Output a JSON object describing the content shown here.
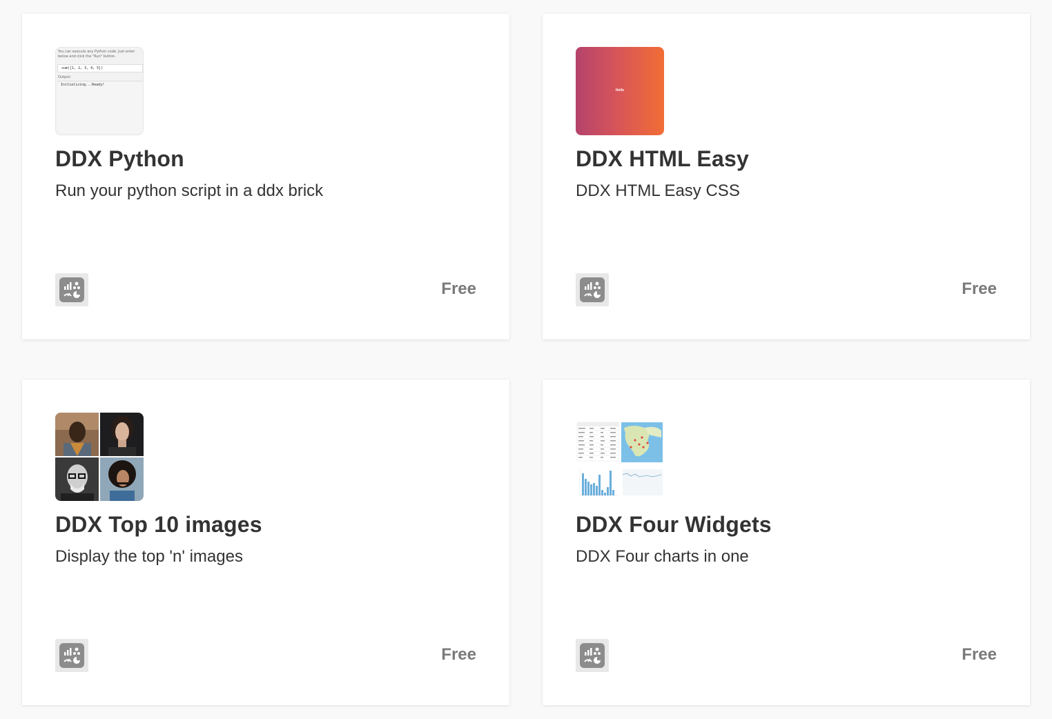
{
  "cards": [
    {
      "title": "DDX Python",
      "description": "Run your python script in a ddx brick",
      "price": "Free",
      "thumbnail": {
        "hint": "You can execute any Python code. Just enter below and click the \"Run\" button.",
        "code": "sum([1, 2, 3, 4, 5])",
        "output_label": "Output:",
        "output": "Initializing...Ready!"
      }
    },
    {
      "title": "DDX HTML Easy",
      "description": "DDX HTML Easy CSS",
      "price": "Free",
      "thumbnail": {
        "text": "Hello"
      }
    },
    {
      "title": "DDX Top 10 images",
      "description": "Display the top 'n' images",
      "price": "Free"
    },
    {
      "title": "DDX Four Widgets",
      "description": "DDX Four charts in one",
      "price": "Free"
    }
  ],
  "colors": {
    "page_background": "#f9f9f9",
    "card_background": "#ffffff",
    "text": "#333333",
    "price": "#7a7a7a",
    "gradient_start": "#b4436c",
    "gradient_end": "#f26d35",
    "badge_icon": "#8c8c8c"
  },
  "icons": {
    "badge": "widgets-analytics-icon"
  }
}
